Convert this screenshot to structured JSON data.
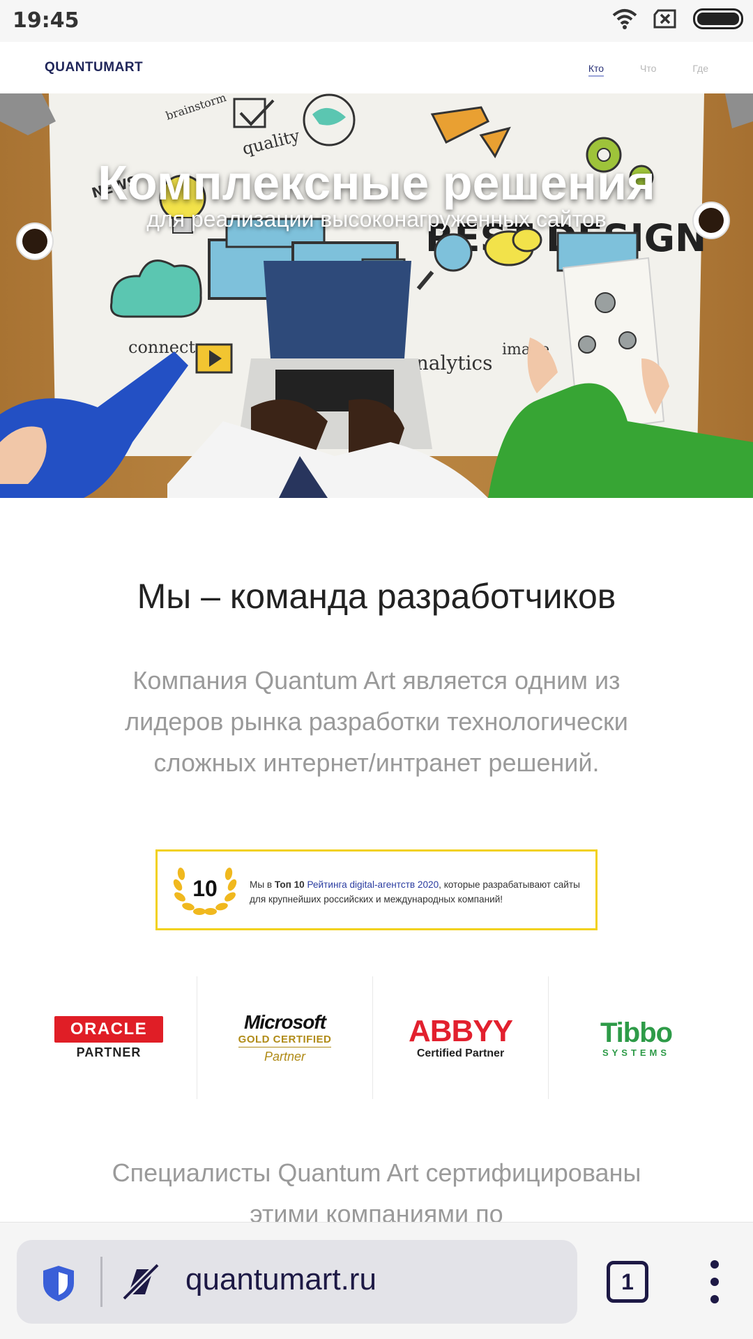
{
  "status_bar": {
    "time": "19:45"
  },
  "site": {
    "logo": "QUANTUMART",
    "nav": [
      "Кто",
      "Что",
      "Где"
    ]
  },
  "hero": {
    "title": "Комплексные решения",
    "subtitle": "для реализации высоконагруженных сайтов",
    "doodle_words": [
      "quality",
      "brainstorm",
      "REST DESIGN",
      "connect",
      "analytics",
      "image",
      "NEWS"
    ]
  },
  "section": {
    "title": "Мы – команда разработчиков",
    "intro": "Компания Quantum Art является одним из лидеров рынка разработки технологически сложных интернет/интранет решений."
  },
  "award": {
    "badge": "10",
    "prefix": "Мы в ",
    "bold": "Топ 10",
    "link_text": "Рейтинга digital-агентств 2020",
    "suffix": ", которые разрабатывают сайты для крупнейших российских и международных компаний!"
  },
  "partners": {
    "oracle": {
      "name": "ORACLE",
      "sub": "PARTNER",
      "color": "#e01e26"
    },
    "microsoft": {
      "name": "Microsoft",
      "sub": "GOLD CERTIFIED",
      "sub2": "Partner",
      "color": "#b08b17"
    },
    "abbyy": {
      "name": "ABBYY",
      "sub": "Certified Partner",
      "color": "#e2202e"
    },
    "tibbo": {
      "name": "Tibbo",
      "sub": "SYSTEMS",
      "color": "#2e9b48"
    }
  },
  "specialists_text": "Специалисты Quantum Art сертифицированы этими компаниями по",
  "browser": {
    "url": "quantumart.ru",
    "tab_count": "1"
  }
}
